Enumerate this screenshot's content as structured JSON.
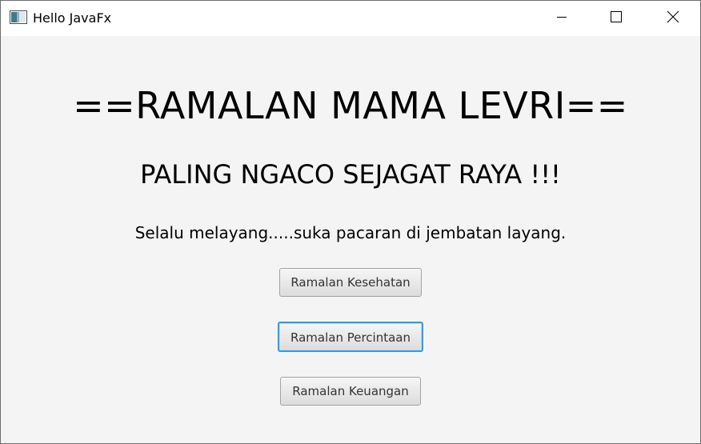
{
  "window": {
    "title": "Hello JavaFx",
    "controls": {
      "minimize_icon": "minimize-icon",
      "maximize_icon": "maximize-icon",
      "close_icon": "close-icon"
    }
  },
  "main": {
    "title": "==RAMALAN MAMA LEVRI==",
    "subtitle": "PALING NGACO SEJAGAT RAYA !!!",
    "tagline": "Selalu melayang.....suka pacaran di jembatan layang.",
    "buttons": [
      {
        "label": "Ramalan Kesehatan"
      },
      {
        "label": "Ramalan Percintaan",
        "focused": true
      },
      {
        "label": "Ramalan Keuangan"
      }
    ]
  },
  "colors": {
    "background": "#f4f4f4",
    "titlebar": "#ffffff",
    "focus_ring": "#3a9ad9"
  }
}
